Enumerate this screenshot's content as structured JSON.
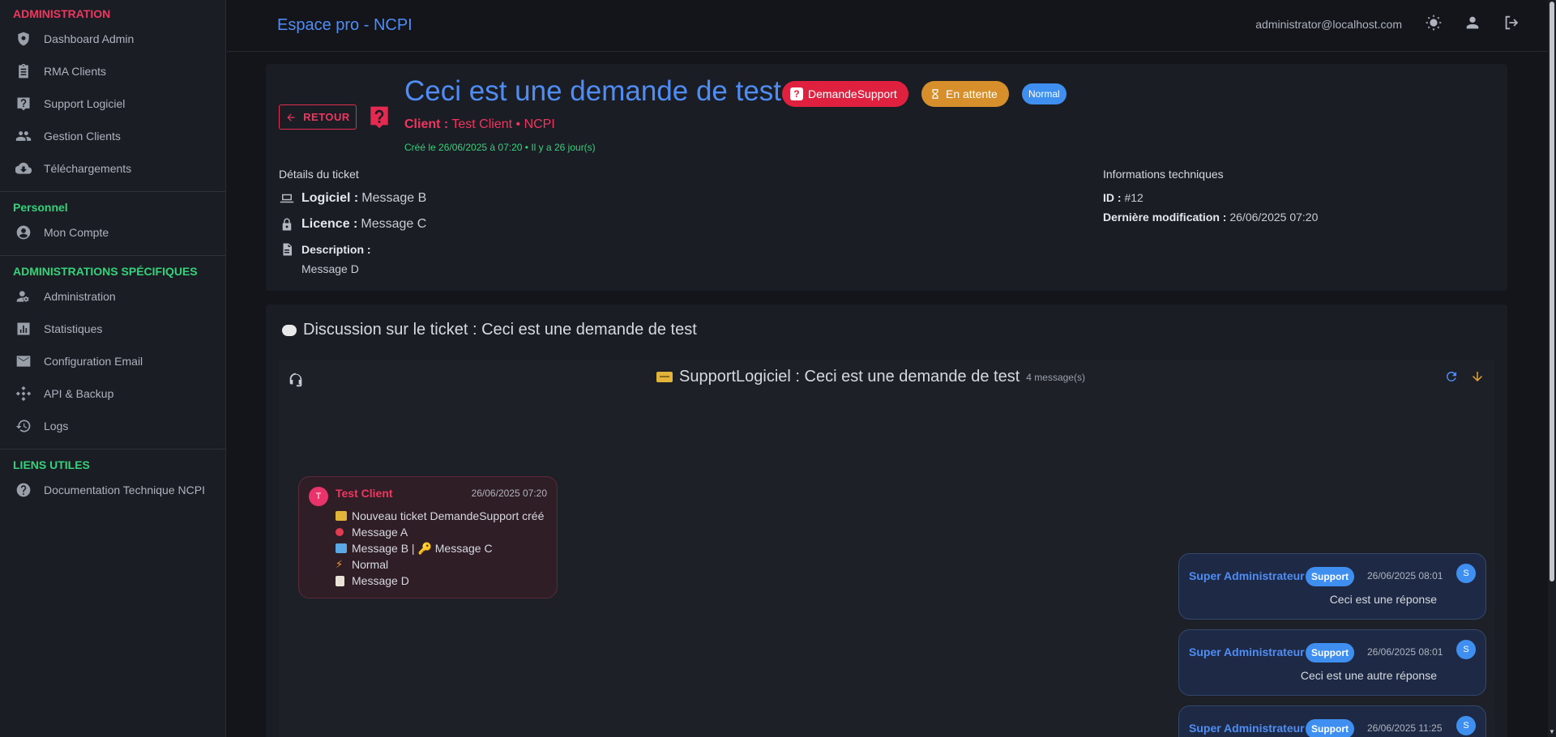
{
  "sidebar": {
    "sections": [
      {
        "title": "ADMINISTRATION",
        "items": [
          "Dashboard Admin",
          "RMA Clients",
          "Support Logiciel",
          "Gestion Clients",
          "Téléchargements"
        ]
      },
      {
        "title": "Personnel",
        "items": [
          "Mon Compte"
        ]
      },
      {
        "title": "ADMINISTRATIONS SPÉCIFIQUES",
        "items": [
          "Administration",
          "Statistiques",
          "Configuration Email",
          "API & Backup",
          "Logs"
        ]
      },
      {
        "title": "LIENS UTILES",
        "items": [
          "Documentation Technique NCPI"
        ]
      }
    ]
  },
  "topbar": {
    "title": "Espace pro - NCPI",
    "email": "administrator@localhost.com"
  },
  "ticket": {
    "back_label": "RETOUR",
    "title": "Ceci est une demande de test",
    "type_badge": "DemandeSupport",
    "status_badge": "En attente",
    "priority_badge": "Normal",
    "client_label": "Client :",
    "client_value": "Test Client • NCPI",
    "created": "Créé le 26/06/2025 à 07:20 • Il y a 26 jour(s)",
    "details_title": "Détails du ticket",
    "logiciel_label": "Logiciel :",
    "logiciel_value": "Message B",
    "licence_label": "Licence :",
    "licence_value": "Message C",
    "description_label": "Description :",
    "description_value": "Message D",
    "tech_title": "Informations techniques",
    "id_label": "ID :",
    "id_value": "#12",
    "modified_label": "Dernière modification :",
    "modified_value": "26/06/2025 07:20"
  },
  "discussion": {
    "title": "Discussion sur le ticket : Ceci est une demande de test",
    "chat_title": "SupportLogiciel : Ceci est une demande de test",
    "message_count": "4 message(s)",
    "messages": [
      {
        "author": "Test Client",
        "initial": "T",
        "time": "26/06/2025 07:20",
        "lines": [
          "Nouveau ticket DemandeSupport créé",
          "Message A",
          "Message B | 🔑 Message C",
          "Normal",
          "Message D"
        ]
      },
      {
        "author": "Super Administrateur",
        "badge": "Support",
        "initial": "S",
        "time": "26/06/2025 08:01",
        "text": "Ceci est une réponse"
      },
      {
        "author": "Super Administrateur",
        "badge": "Support",
        "initial": "S",
        "time": "26/06/2025 08:01",
        "text": "Ceci est une autre réponse"
      },
      {
        "author": "Super Administrateur",
        "badge": "Support",
        "initial": "S",
        "time": "26/06/2025 11:25",
        "text": ""
      }
    ]
  },
  "colors": {
    "accent": "#4f8df5",
    "danger": "#f0365f",
    "success": "#34d27a",
    "warning": "#d68f2a"
  }
}
